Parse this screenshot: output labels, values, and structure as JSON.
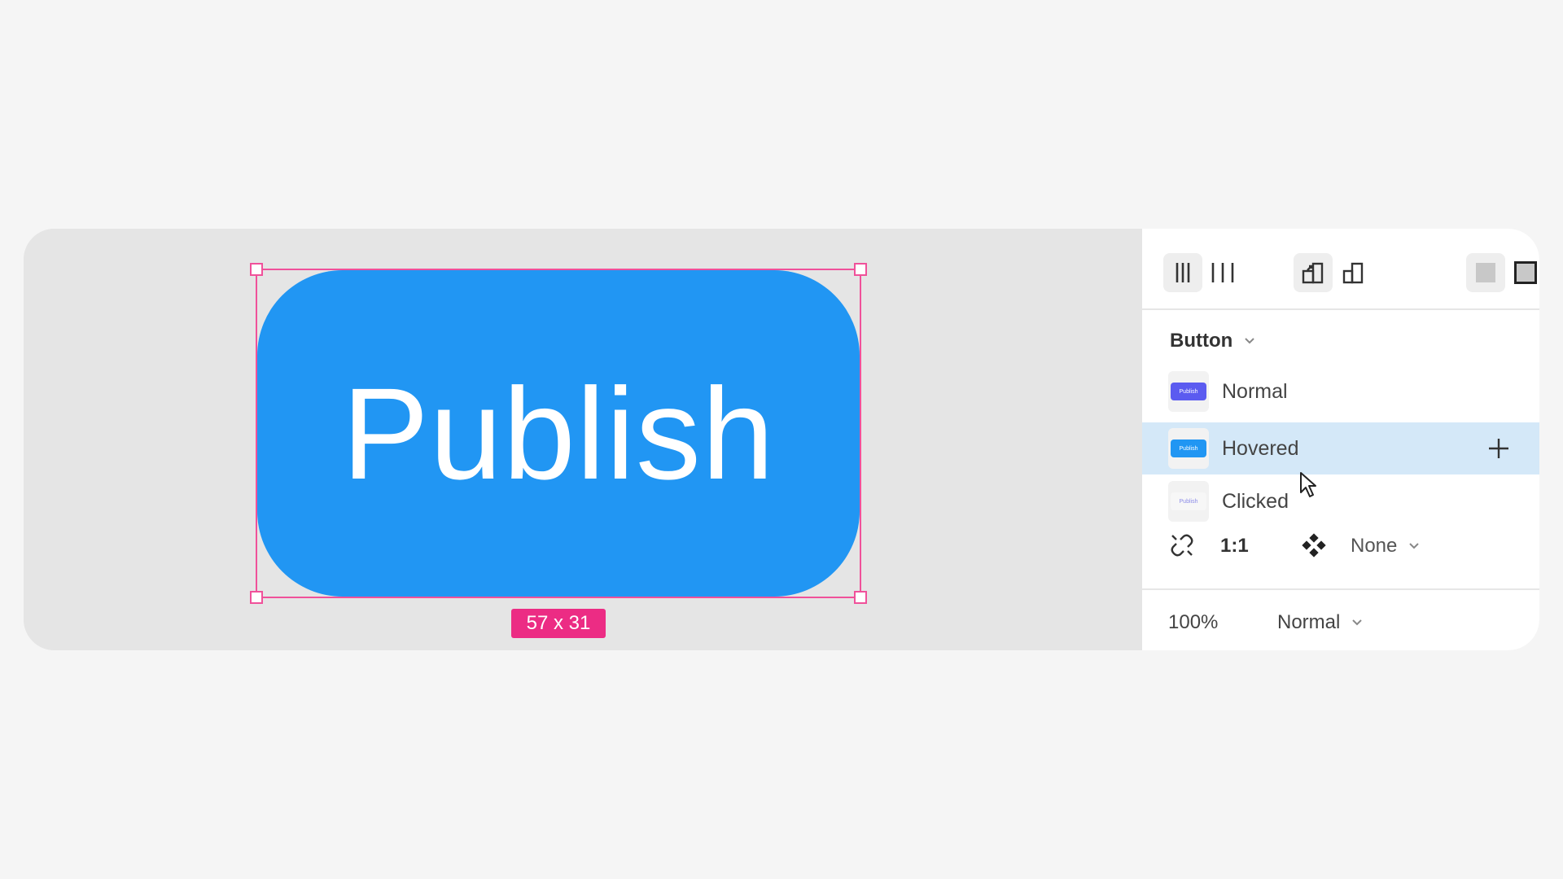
{
  "canvas": {
    "button_text": "Publish",
    "button_color": "#2196f3",
    "selection_color": "#f0519a",
    "size_label": "57 x 31"
  },
  "toolbar": {
    "icons": [
      "align-columns-icon",
      "distribute-columns-icon",
      "scale-up-icon",
      "scale-down-icon",
      "fill-square-icon",
      "stroke-square-icon"
    ]
  },
  "panel": {
    "component_title": "Button",
    "variants": [
      {
        "label": "Normal",
        "thumb_color": "#5b5bf0",
        "thumb_text": "Publish"
      },
      {
        "label": "Hovered",
        "thumb_color": "#2196f3",
        "thumb_text": "Publish",
        "selected": true
      },
      {
        "label": "Clicked",
        "thumb_color": "#f2f2f2",
        "thumb_text": "Publish"
      }
    ],
    "ratio_label": "1:1",
    "component_value": "None",
    "opacity": "100%",
    "blend_mode": "Normal",
    "selected_color": "#d4e8f8"
  }
}
